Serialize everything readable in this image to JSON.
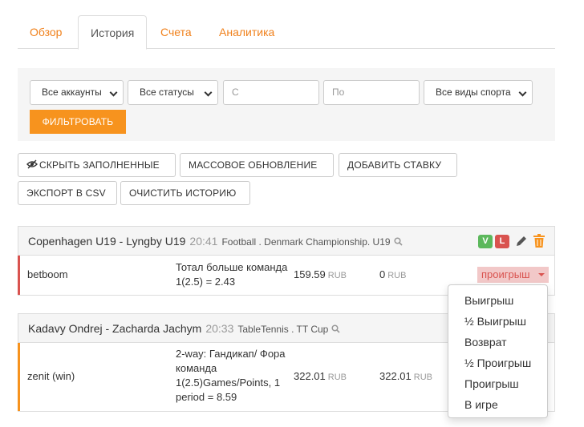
{
  "tabs": [
    {
      "label": "Обзор",
      "active": false
    },
    {
      "label": "История",
      "active": true
    },
    {
      "label": "Счета",
      "active": false
    },
    {
      "label": "Аналитика",
      "active": false
    }
  ],
  "filters": {
    "accounts": "Все аккаунты",
    "statuses": "Все статусы",
    "from_placeholder": "С",
    "to_placeholder": "По",
    "sports": "Все виды спорта",
    "filter_button": "ФИЛЬТРОВАТЬ"
  },
  "actions": {
    "hide_filled": "СКРЫТЬ ЗАПОЛНЕННЫЕ",
    "mass_update": "МАССОВОЕ ОБНОВЛЕНИЕ",
    "add_bet": "ДОБАВИТЬ СТАВКУ",
    "export_csv": "ЭКСПОРТ В CSV",
    "clear_history": "ОЧИСТИТЬ ИСТОРИЮ"
  },
  "bets": [
    {
      "match": "Copenhagen U19 - Lyngby U19",
      "time": "20:41",
      "league": "Football . Denmark Championship. U19",
      "account": "betboom",
      "description": "Тотал больше команда 1(2.5) = 2.43",
      "stake": "159.59",
      "stake_currency": "RUB",
      "win": "0",
      "win_currency": "RUB",
      "status": "проигрыш",
      "badge_v": "V",
      "badge_l": "L",
      "accent_color": "#d9534f"
    },
    {
      "match": "Kadavy Ondrej - Zacharda Jachym",
      "time": "20:33",
      "league": "TableTennis . TT Cup",
      "account": "zenit (win)",
      "description": "2-way: Гандикап/ Фора команда 1(2.5)Games/Points, 1 period = 8.59",
      "stake": "322.01",
      "stake_currency": "RUB",
      "win": "322.01",
      "win_currency": "RUB",
      "accent_color": "#f7931e"
    }
  ],
  "status_menu": [
    "Выигрыш",
    "½ Выигрыш",
    "Возврат",
    "½ Проигрыш",
    "Проигрыш",
    "В игре"
  ],
  "colors": {
    "accent": "#f7931e",
    "win": "#5cb85c",
    "loss": "#d9534f"
  }
}
